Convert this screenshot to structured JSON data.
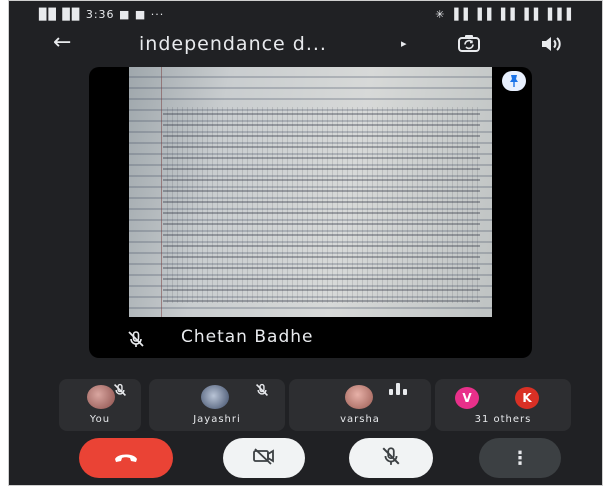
{
  "status_bar": {
    "left": "▉▉ ▉▉ 3:36 ■ ■ ···",
    "right": "✳ ▐▐ ▐▐ ▐▐ ▐▐ ▐▐▐"
  },
  "header": {
    "back_icon": "←",
    "title": "independance d...",
    "title_chevron": "▸",
    "switch_camera_icon": "switch-camera-icon",
    "speaker_icon": "speaker-icon"
  },
  "main_tile": {
    "presenter_name": "Chetan Badhe",
    "mic_muted": true,
    "pin_icon": "pin-icon"
  },
  "participants": [
    {
      "label": "You",
      "muted": true
    },
    {
      "label": "Jayashri",
      "muted": true
    },
    {
      "label": "varsha",
      "speaking": true
    },
    {
      "label": "31 others",
      "avatars": [
        "V",
        "K"
      ]
    }
  ],
  "controls": {
    "end_call_icon": "end-call-icon",
    "camera_icon": "camera-off-icon",
    "mic_icon": "mic-off-icon",
    "more_icon": "⋮"
  },
  "colors": {
    "background": "#202124",
    "tile": "#2d2e31",
    "end_call": "#ea4335",
    "avatar_v": "#e8308a",
    "avatar_k": "#d93025"
  }
}
